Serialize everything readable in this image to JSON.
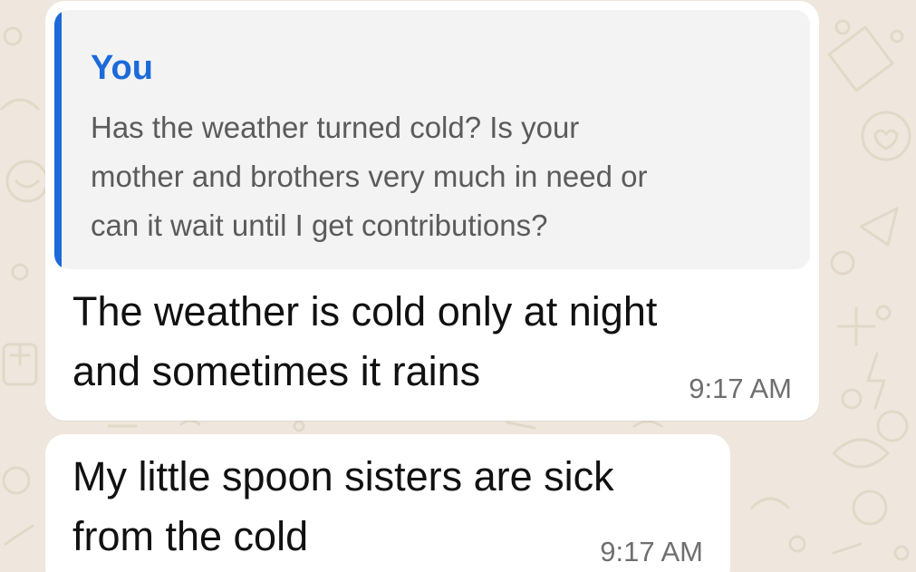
{
  "colors": {
    "wallpaper": "#efe7dd",
    "bubble": "#ffffff",
    "quote_background": "#f3f3f4",
    "quote_accent": "#1c6ad9",
    "timestamp": "#6f6f6f"
  },
  "messages": [
    {
      "quoted": {
        "author": "You",
        "lines": [
          "Has the weather turned cold? Is your",
          "mother and brothers very much in need or",
          "can it wait until I get contributions?"
        ]
      },
      "lines": [
        "The weather is cold only at night",
        "and sometimes it rains"
      ],
      "time": "9:17 AM"
    },
    {
      "lines": [
        "My little spoon sisters are sick",
        "from the cold"
      ],
      "time": "9:17 AM"
    }
  ]
}
